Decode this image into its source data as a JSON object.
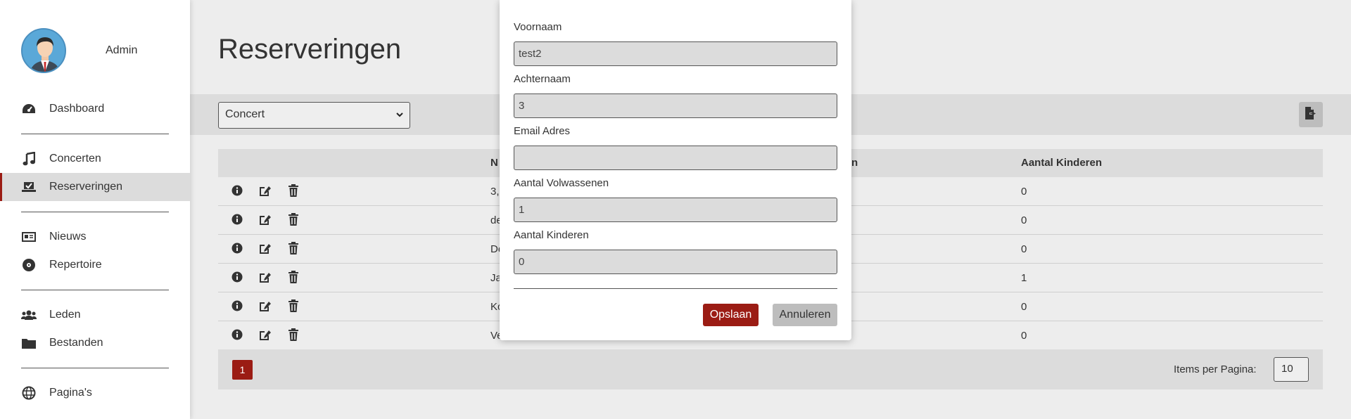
{
  "profile": {
    "name": "Admin"
  },
  "nav": {
    "dashboard": "Dashboard",
    "concerten": "Concerten",
    "reserveringen": "Reserveringen",
    "nieuws": "Nieuws",
    "repertoire": "Repertoire",
    "leden": "Leden",
    "bestanden": "Bestanden",
    "paginas": "Pagina's"
  },
  "page": {
    "title": "Reserveringen"
  },
  "filter": {
    "selected": "Concert"
  },
  "table": {
    "headers": {
      "name": "N",
      "adults_partial": "n",
      "kids": "Aantal Kinderen"
    },
    "rows": [
      {
        "name": "3,",
        "kids": "0"
      },
      {
        "name": "de",
        "kids": "0"
      },
      {
        "name": "De",
        "kids": "0"
      },
      {
        "name": "Ja",
        "kids": "1"
      },
      {
        "name": "Ko",
        "kids": "0"
      },
      {
        "name": "Ve",
        "kids": "0"
      }
    ]
  },
  "pager": {
    "page": "1",
    "items_label": "Items per Pagina:",
    "items_value": "10"
  },
  "modal": {
    "voornaam_label": "Voornaam",
    "voornaam_value": "test2",
    "achternaam_label": "Achternaam",
    "achternaam_value": "3",
    "email_label": "Email Adres",
    "email_value": "",
    "volw_label": "Aantal Volwassenen",
    "volw_value": "1",
    "kind_label": "Aantal Kinderen",
    "kind_value": "0",
    "save": "Opslaan",
    "cancel": "Annuleren"
  },
  "colors": {
    "accent": "#9b1c14",
    "panel": "#dcdcdc"
  }
}
